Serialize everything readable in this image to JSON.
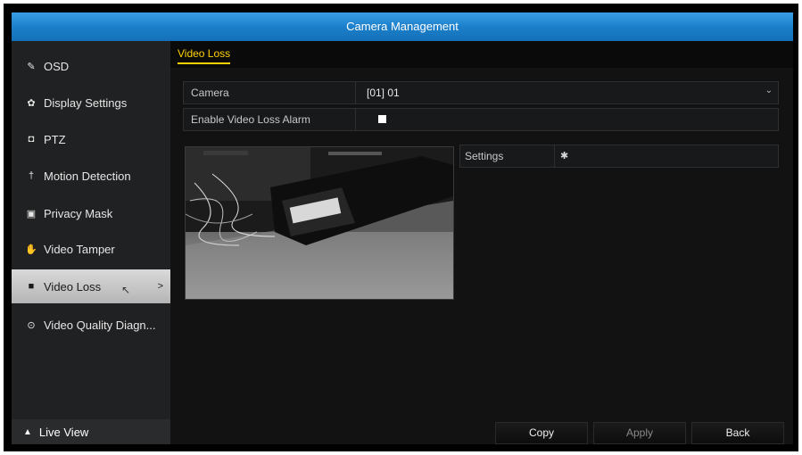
{
  "title": "Camera Management",
  "sidebar": {
    "items": [
      {
        "label": "OSD",
        "icon": "osd-icon",
        "glyph": "✎"
      },
      {
        "label": "Display Settings",
        "icon": "display-settings-icon",
        "glyph": "✿"
      },
      {
        "label": "PTZ",
        "icon": "ptz-icon",
        "glyph": "◘"
      },
      {
        "label": "Motion Detection",
        "icon": "motion-detection-icon",
        "glyph": "†"
      },
      {
        "label": "Privacy Mask",
        "icon": "privacy-mask-icon",
        "glyph": "▣"
      },
      {
        "label": "Video Tamper",
        "icon": "video-tamper-icon",
        "glyph": "✋"
      },
      {
        "label": "Video Loss",
        "icon": "video-loss-icon",
        "glyph": "■",
        "active": true
      },
      {
        "label": "Video Quality Diagn...",
        "icon": "video-quality-icon",
        "glyph": "⊙"
      }
    ],
    "live_view": "Live View",
    "live_view_glyph": "▲"
  },
  "tab": {
    "label": "Video Loss"
  },
  "form": {
    "camera_label": "Camera",
    "camera_value": "[01] 01",
    "enable_label": "Enable Video Loss Alarm",
    "enable_checked": false,
    "settings_label": "Settings"
  },
  "buttons": {
    "copy": "Copy",
    "apply": "Apply",
    "back": "Back"
  },
  "colors": {
    "title_bar": "#1c7fcb",
    "tab_accent": "#ffd200",
    "active_item": "#c8c8c8"
  }
}
